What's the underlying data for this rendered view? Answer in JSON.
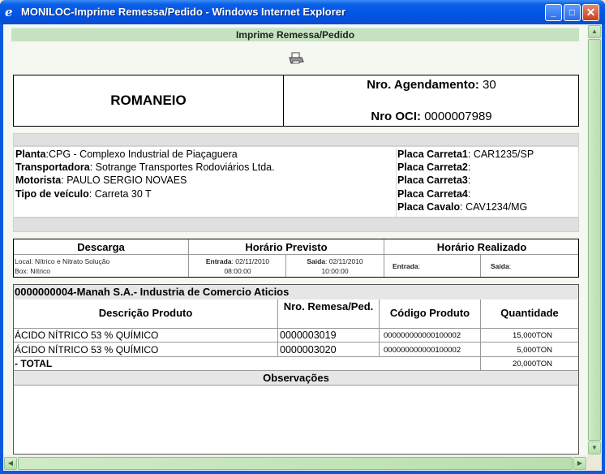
{
  "window": {
    "title": "MONILOC-Imprime Remessa/Pedido - Windows Internet Explorer",
    "icon": "ie-icon",
    "buttons": {
      "minimize": "_",
      "maximize": "□",
      "close": "✕"
    }
  },
  "page": {
    "header": "Imprime Remessa/Pedido",
    "print_icon": "printer-icon"
  },
  "romaneio": {
    "title": "ROMANEIO",
    "agendamento_label": "Nro. Agendamento:",
    "agendamento_value": "30",
    "oci_label": "Nro OCI:",
    "oci_value": "0000007989"
  },
  "info": {
    "planta_label": "Planta",
    "planta_value": ":CPG - Complexo Industrial de Piaçaguera",
    "transportadora_label": "Transportadora",
    "transportadora_value": ": Sotrange Transportes Rodoviários Ltda.",
    "motorista_label": "Motorista",
    "motorista_value": ": PAULO SERGIO NOVAES",
    "tipo_label": "Tipo de veículo",
    "tipo_value": ": Carreta 30 T",
    "carreta1_label": "Placa Carreta1",
    "carreta1_value": ": CAR1235/SP",
    "carreta2_label": "Placa Carreta2",
    "carreta2_value": ":",
    "carreta3_label": "Placa Carreta3",
    "carreta3_value": ":",
    "carreta4_label": "Placa Carreta4",
    "carreta4_value": ":",
    "cavalo_label": "Placa Cavalo",
    "cavalo_value": ": CAV1234/MG"
  },
  "schedule": {
    "descarga_header": "Descarga",
    "previsto_header": "Horário Previsto",
    "realizado_header": "Horário Realizado",
    "local_label": "Local",
    "local_value": ": Nítrico e Nitrato Solução",
    "box_label": "Box",
    "box_value": ": Nítrico",
    "entrada_label": "Entrada",
    "entrada_date": ": 02/11/2010",
    "entrada_time": "08:00:00",
    "saida_label": "Saida",
    "saida_date": ": 02/11/2010",
    "saida_time": "10:00:00",
    "realizado_entrada_label": "Entrada",
    "realizado_entrada_value": ":",
    "realizado_saida_label": "Saida",
    "realizado_saida_value": ":"
  },
  "orders": {
    "company": "0000000004-Manah S.A.- Industria de Comercio Aticios",
    "columns": {
      "descricao": "Descrição Produto",
      "remessa": "Nro. Remesa/Ped.",
      "codigo": "Código Produto",
      "quantidade": "Quantidade"
    },
    "rows": [
      {
        "descricao": "ÁCIDO NÍTRICO 53 % QUÍMICO",
        "remessa": "0000003019",
        "codigo": "000000000000100002",
        "quantidade": "15,000TON"
      },
      {
        "descricao": "ÁCIDO NÍTRICO 53 % QUÍMICO",
        "remessa": "0000003020",
        "codigo": "000000000000100002",
        "quantidade": "5,000TON"
      }
    ],
    "total_label": "- TOTAL",
    "total_value": "20,000TON",
    "observacoes": "Observações"
  }
}
